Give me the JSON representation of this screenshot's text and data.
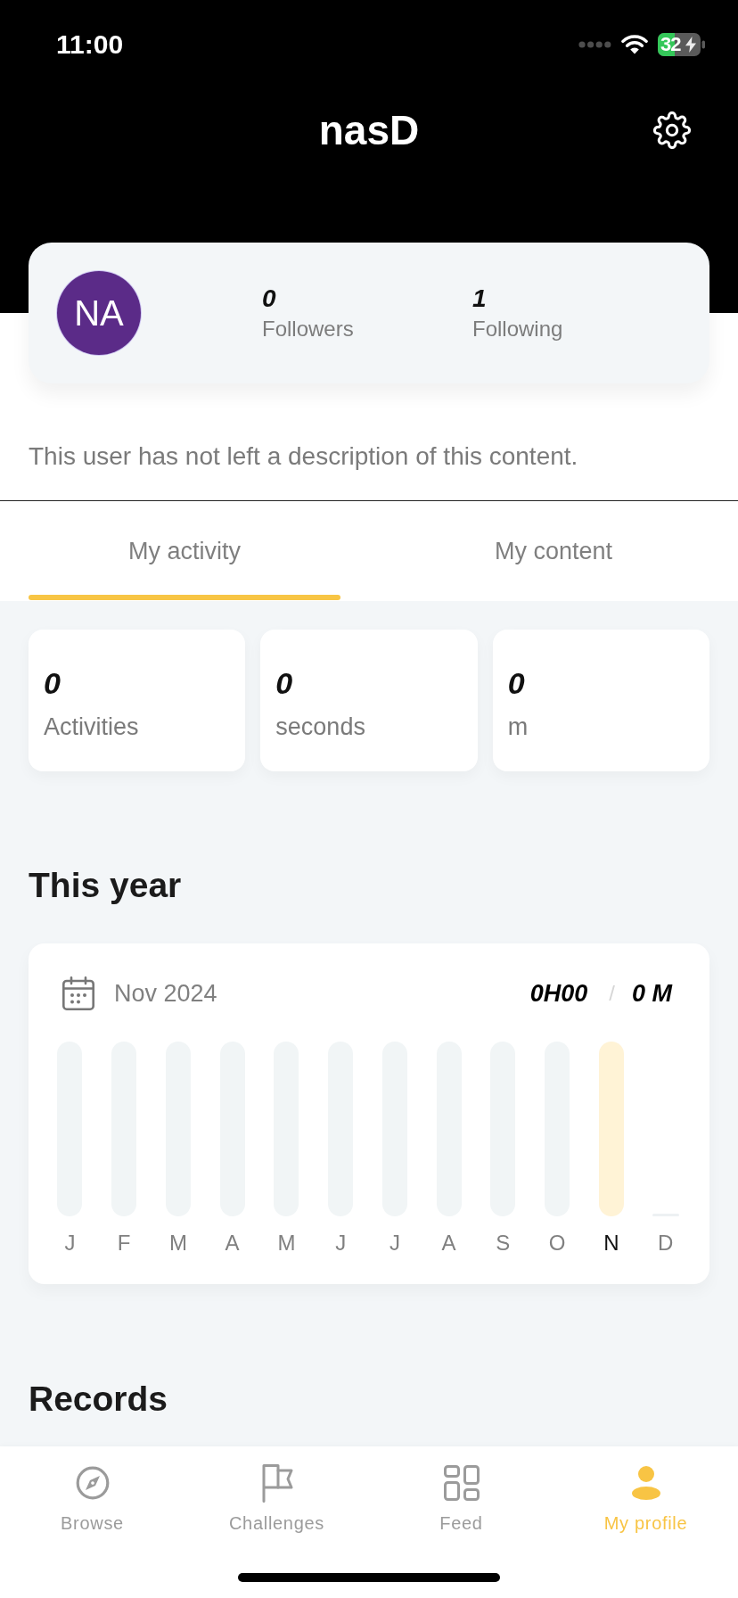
{
  "status_bar": {
    "time": "11:00",
    "battery": "32",
    "charging": true
  },
  "header": {
    "title": "nasD"
  },
  "profile": {
    "initials": "NA",
    "stats": [
      {
        "value": "0",
        "label": "Followers"
      },
      {
        "value": "1",
        "label": "Following"
      }
    ],
    "description": "This user has not left a description of this content."
  },
  "tabs": [
    {
      "label": "My activity",
      "selected": true
    },
    {
      "label": "My content",
      "selected": false
    }
  ],
  "summary": [
    {
      "value": "0",
      "label": "Activities"
    },
    {
      "value": "0",
      "label": "seconds"
    },
    {
      "value": "0",
      "label": "m"
    }
  ],
  "this_year": {
    "title": "This year",
    "period": "Nov 2024",
    "duration": "0H00",
    "separator": "/",
    "distance": "0 M",
    "months": [
      {
        "label": "J",
        "kind": "bar",
        "selected": false
      },
      {
        "label": "F",
        "kind": "bar",
        "selected": false
      },
      {
        "label": "M",
        "kind": "bar",
        "selected": false
      },
      {
        "label": "A",
        "kind": "bar",
        "selected": false
      },
      {
        "label": "M",
        "kind": "bar",
        "selected": false
      },
      {
        "label": "J",
        "kind": "bar",
        "selected": false
      },
      {
        "label": "J",
        "kind": "bar",
        "selected": false
      },
      {
        "label": "A",
        "kind": "bar",
        "selected": false
      },
      {
        "label": "S",
        "kind": "bar",
        "selected": false
      },
      {
        "label": "O",
        "kind": "bar",
        "selected": false
      },
      {
        "label": "N",
        "kind": "bar",
        "selected": true
      },
      {
        "label": "D",
        "kind": "baseline",
        "selected": false
      }
    ]
  },
  "records": {
    "title": "Records"
  },
  "tab_bar": [
    {
      "label": "Browse",
      "selected": false
    },
    {
      "label": "Challenges",
      "selected": false
    },
    {
      "label": "Feed",
      "selected": false
    },
    {
      "label": "My profile",
      "selected": true
    }
  ]
}
